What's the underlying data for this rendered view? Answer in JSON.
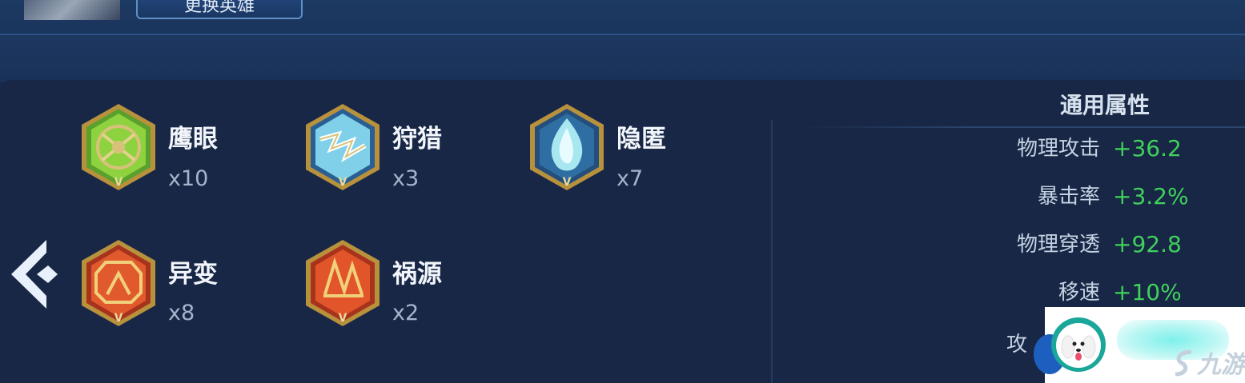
{
  "header": {
    "swap_hero_label": "更换英雄"
  },
  "emblems": [
    {
      "name": "鹰眼",
      "count": "x10",
      "theme": "green"
    },
    {
      "name": "狩猎",
      "count": "x3",
      "theme": "blue"
    },
    {
      "name": "隐匿",
      "count": "x7",
      "theme": "blue"
    },
    {
      "name": "异变",
      "count": "x8",
      "theme": "red"
    },
    {
      "name": "祸源",
      "count": "x2",
      "theme": "red"
    }
  ],
  "attributes": {
    "title": "通用属性",
    "items": [
      {
        "label": "物理攻击",
        "value": "+36.2"
      },
      {
        "label": "暴击率",
        "value": "+3.2%"
      },
      {
        "label": "物理穿透",
        "value": "+92.8"
      },
      {
        "label": "移速",
        "value": "+10%"
      }
    ],
    "partial_label": "攻"
  },
  "watermark": {
    "text": "九游"
  },
  "colors": {
    "background": "#182746",
    "accent_green": "#3fd15b",
    "gold": "#c9a34c"
  }
}
